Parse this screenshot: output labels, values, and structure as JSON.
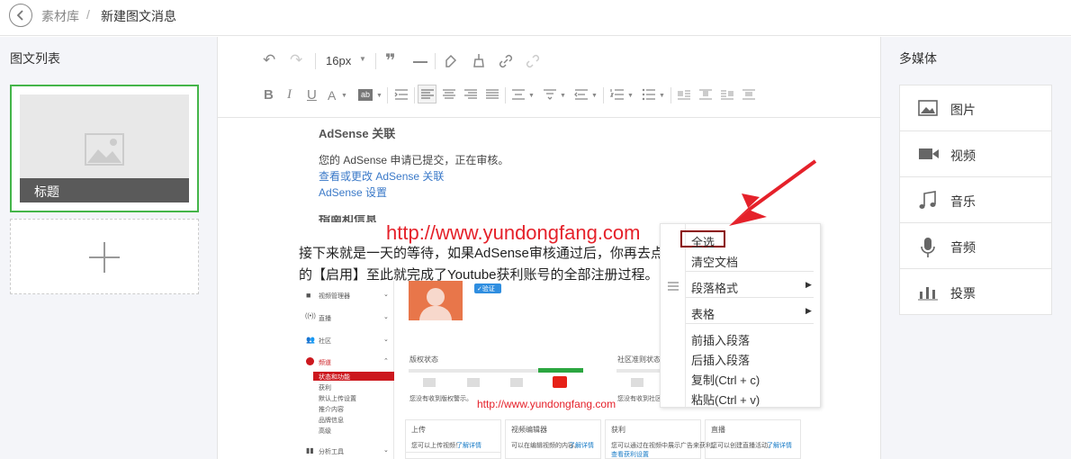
{
  "breadcrumb": {
    "root": "素材库",
    "separator": "/",
    "current": "新建图文消息"
  },
  "left_panel": {
    "title": "图文列表",
    "card_title": "标题"
  },
  "toolbar": {
    "font_size": "16px"
  },
  "content": {
    "heading": "AdSense 关联",
    "status_text": "您的 AdSense 申请已提交，正在审核。",
    "link1": "查看或更改 AdSense 关联",
    "link2": "AdSense 设置",
    "cutoff_text": "指南和信息",
    "watermark": "http://www.yundongfang.com",
    "para_line1": "接下来就是一天的等待，如果AdSense审核通过后，你再去点",
    "para_line2": "的【启用】至此就完成了Youtube获利账号的全部注册过程。"
  },
  "embedded_shot": {
    "verify_badge": "✓验证",
    "sidebar": [
      "视频管理器",
      "直播",
      "社区",
      "频道",
      "状态和功能",
      "获利",
      "默认上传设置",
      "推介内容",
      "品牌信息",
      "高级",
      "分析工具"
    ],
    "copyright_status": "版权状态",
    "community_status": "社区准则状态",
    "copyright_note": "您没有收到版权警示。",
    "community_note": "您没有收到社区",
    "watermark": "http://www.yundongfang.com",
    "cards": [
      {
        "title": "上传",
        "desc": "您可以上传视频！",
        "link": "了解详情"
      },
      {
        "title": "视频编辑器",
        "desc": "可以在编辑视频的内容。",
        "link": "了解详情"
      },
      {
        "title": "获利",
        "desc": "您可以通过在视频中展示广告来获利。",
        "link": "查看获利设置"
      },
      {
        "title": "直播",
        "desc": "您可以创建直播活动。",
        "link": "了解详情"
      }
    ]
  },
  "context_menu": {
    "items": [
      "全选",
      "清空文档",
      "段落格式",
      "表格",
      "前插入段落",
      "后插入段落",
      "复制(Ctrl + c)",
      "粘贴(Ctrl + v)"
    ]
  },
  "right_panel": {
    "title": "多媒体",
    "items": [
      {
        "label": "图片",
        "icon": "image-icon"
      },
      {
        "label": "视频",
        "icon": "video-icon"
      },
      {
        "label": "音乐",
        "icon": "music-icon"
      },
      {
        "label": "音频",
        "icon": "microphone-icon"
      },
      {
        "label": "投票",
        "icon": "vote-icon"
      }
    ]
  },
  "colors": {
    "accent_green": "#44b549",
    "link_blue": "#3a79c8",
    "annotation_red": "#e5212a",
    "highlight_dark_red": "#8b0000"
  }
}
